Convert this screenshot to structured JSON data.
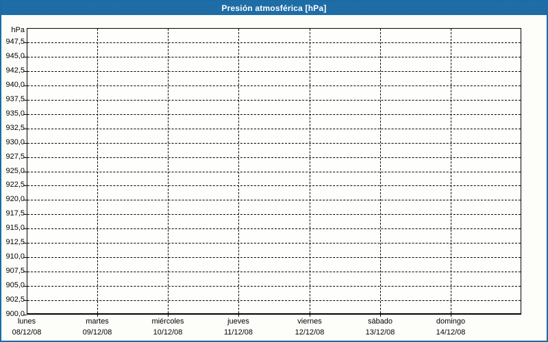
{
  "window": {
    "title": "Presión atmosférica [hPa]"
  },
  "colors": {
    "frame": "#1C6BA4",
    "frame_dot": "#2674AC",
    "title_text": "#FFFFFF",
    "grid": "#000000",
    "text": "#000000",
    "plot_bg": "#FEFEFC",
    "page_bg": "#FDFDFA"
  },
  "chart_data": {
    "type": "line",
    "title": "Presión atmosférica [hPa]",
    "y_unit": "hPa",
    "ylim": [
      900,
      950
    ],
    "y_tick_step": 2.5,
    "grid": true,
    "legend_position": "none",
    "x_divisions": 7,
    "y_ticks": [
      {
        "value": 947.5,
        "label": "947,5"
      },
      {
        "value": 945.0,
        "label": "945,0"
      },
      {
        "value": 942.5,
        "label": "942,5"
      },
      {
        "value": 940.0,
        "label": "940,0"
      },
      {
        "value": 937.5,
        "label": "937,5"
      },
      {
        "value": 935.0,
        "label": "935,0"
      },
      {
        "value": 932.5,
        "label": "932,5"
      },
      {
        "value": 930.0,
        "label": "930,0"
      },
      {
        "value": 927.5,
        "label": "927,5"
      },
      {
        "value": 925.0,
        "label": "925,0"
      },
      {
        "value": 922.5,
        "label": "922,5"
      },
      {
        "value": 920.0,
        "label": "920,0"
      },
      {
        "value": 917.5,
        "label": "917,5"
      },
      {
        "value": 915.0,
        "label": "915,0"
      },
      {
        "value": 912.5,
        "label": "912,5"
      },
      {
        "value": 910.0,
        "label": "910,0"
      },
      {
        "value": 907.5,
        "label": "907,5"
      },
      {
        "value": 905.0,
        "label": "905,0"
      },
      {
        "value": 902.5,
        "label": "902,5"
      },
      {
        "value": 900.0,
        "label": "900,0"
      }
    ],
    "x_ticks": [
      {
        "day": "lunes",
        "date": "08/12/08"
      },
      {
        "day": "martes",
        "date": "09/12/08"
      },
      {
        "day": "miércoles",
        "date": "10/12/08"
      },
      {
        "day": "jueves",
        "date": "11/12/08"
      },
      {
        "day": "viernes",
        "date": "12/12/08"
      },
      {
        "day": "sábado",
        "date": "13/12/08"
      },
      {
        "day": "domingo",
        "date": "14/12/08"
      }
    ],
    "series": []
  }
}
